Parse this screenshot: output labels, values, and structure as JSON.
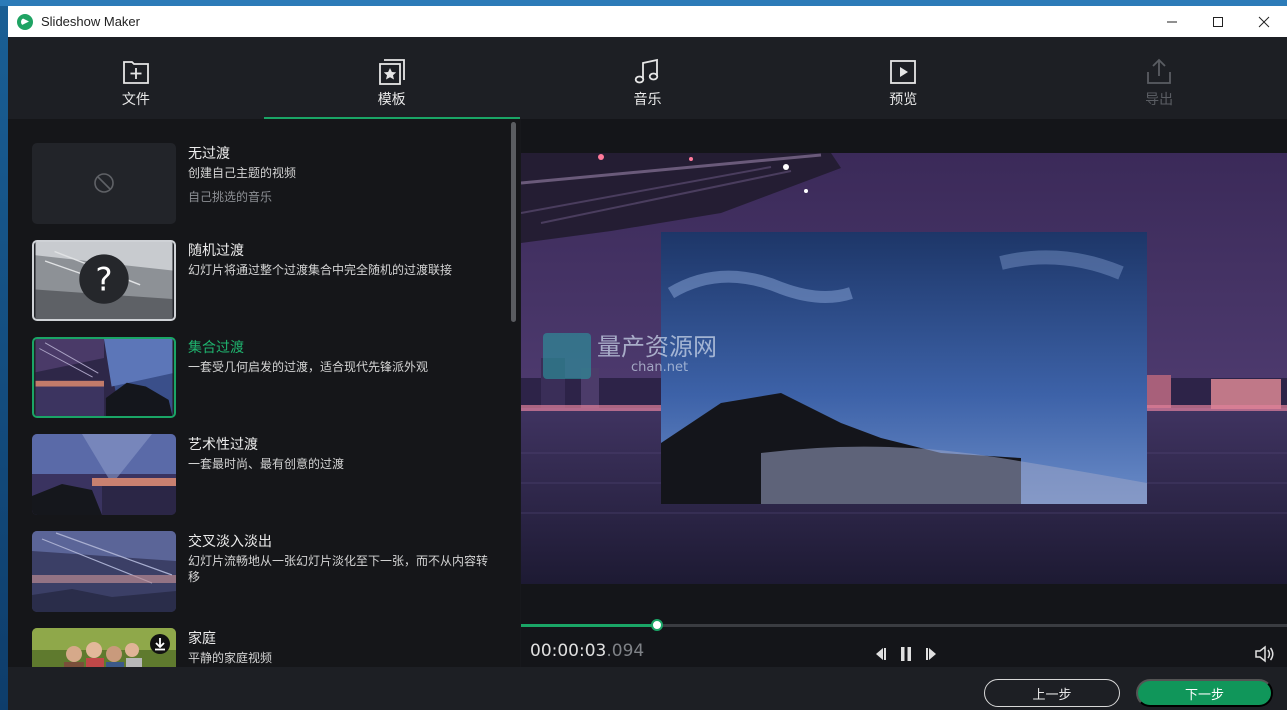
{
  "window": {
    "title": "Slideshow Maker"
  },
  "nav": {
    "tabs": [
      {
        "label": "文件",
        "icon": "add-file-icon",
        "active": false,
        "disabled": false
      },
      {
        "label": "模板",
        "icon": "template-star-icon",
        "active": true,
        "disabled": false
      },
      {
        "label": "音乐",
        "icon": "music-note-icon",
        "active": false,
        "disabled": false
      },
      {
        "label": "预览",
        "icon": "play-preview-icon",
        "active": false,
        "disabled": false
      },
      {
        "label": "导出",
        "icon": "export-upload-icon",
        "active": false,
        "disabled": true
      }
    ]
  },
  "templates": [
    {
      "title": "无过渡",
      "desc": "创建自己主题的视频",
      "desc2": "自己挑选的音乐",
      "thumb": "none"
    },
    {
      "title": "随机过渡",
      "desc": "幻灯片将通过整个过渡集合中完全随机的过渡联接",
      "thumb": "random"
    },
    {
      "title": "集合过渡",
      "desc": "一套受几何启发的过渡，适合现代先锋派外观",
      "thumb": "collection",
      "selected": true
    },
    {
      "title": "艺术性过渡",
      "desc": "一套最时尚、最有创意的过渡",
      "thumb": "art"
    },
    {
      "title": "交叉淡入淡出",
      "desc": "幻灯片流畅地从一张幻灯片淡化至下一张，而不从内容转移",
      "thumb": "crossfade"
    },
    {
      "title": "家庭",
      "desc": "平静的家庭视频",
      "thumb": "family",
      "download": true
    }
  ],
  "player": {
    "time_main": "00:00:03",
    "time_ms": ".094",
    "progress": 0.178
  },
  "watermark": {
    "text1": "量产资源网",
    "text2": "chan.net"
  },
  "footer": {
    "prev_label": "上一步",
    "next_label": "下一步"
  },
  "colors": {
    "accent": "#1aa566",
    "next_button": "#10965a"
  }
}
